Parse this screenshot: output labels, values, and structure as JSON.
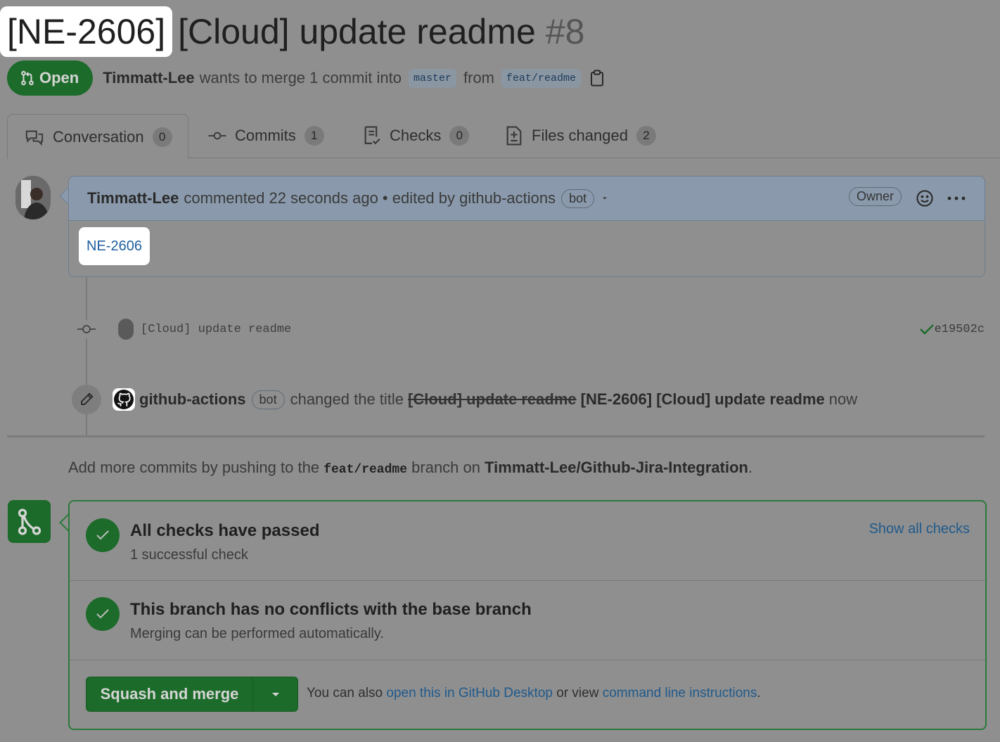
{
  "title": {
    "issue_key": "[NE-2606]",
    "text": "[Cloud] update readme",
    "number": "#8"
  },
  "status": {
    "label": "Open"
  },
  "subtitle": {
    "author": "Timmatt-Lee",
    "action": "wants to merge 1 commit into",
    "base_branch": "master",
    "from": "from",
    "head_branch": "feat/readme"
  },
  "tabs": [
    {
      "label": "Conversation",
      "count": "0"
    },
    {
      "label": "Commits",
      "count": "1"
    },
    {
      "label": "Checks",
      "count": "0"
    },
    {
      "label": "Files changed",
      "count": "2"
    }
  ],
  "comment": {
    "author": "Timmatt-Lee",
    "meta": "commented 22 seconds ago • edited by github-actions",
    "bot_badge": "bot",
    "role_badge": "Owner",
    "body_link": "NE-2606"
  },
  "commit": {
    "message": "[Cloud] update readme",
    "sha": "e19502c"
  },
  "title_event": {
    "actor": "github-actions",
    "bot_badge": "bot",
    "action": "changed the title",
    "old_title": "[Cloud] update readme",
    "new_title": "[NE-2606] [Cloud] update readme",
    "time": "now"
  },
  "push_hint": {
    "prefix": "Add more commits by pushing to the",
    "branch": "feat/readme",
    "middle": "branch on",
    "repo": "Timmatt-Lee/Github-Jira-Integration",
    "suffix": "."
  },
  "merge": {
    "checks_title": "All checks have passed",
    "checks_sub": "1 successful check",
    "show_checks": "Show all checks",
    "conflicts_title": "This branch has no conflicts with the base branch",
    "conflicts_sub": "Merging can be performed automatically.",
    "button_label": "Squash and merge",
    "also_prefix": "You can also",
    "desktop_link": "open this in GitHub Desktop",
    "or_view": "or view",
    "cli_link": "command line instructions",
    "also_suffix": "."
  },
  "colors": {
    "open_green": "#1c6b2a",
    "link_blue": "#1f5a8c",
    "highlight": "#ffffff"
  }
}
